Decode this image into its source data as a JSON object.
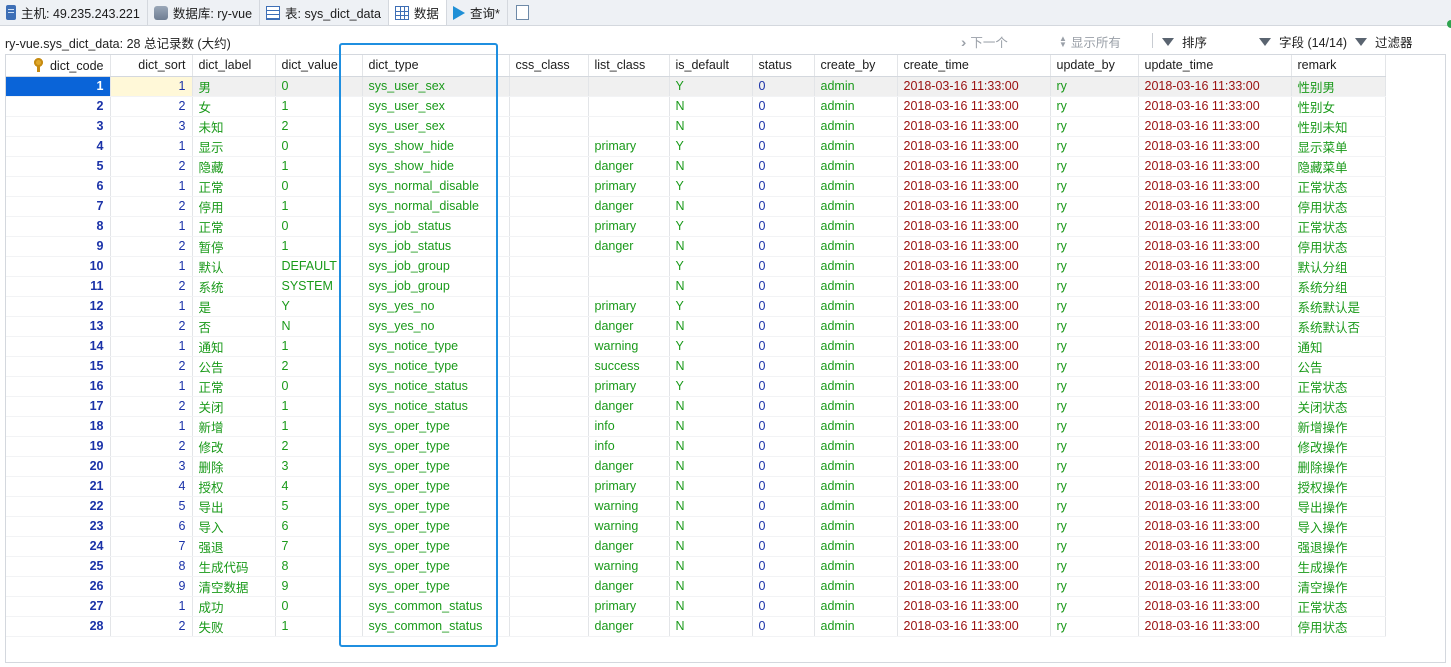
{
  "tabs": [
    {
      "icon": "server-icon",
      "label": "主机: 49.235.243.221"
    },
    {
      "icon": "database-icon",
      "label": "数据库: ry-vue"
    },
    {
      "icon": "table-icon",
      "label": "表: sys_dict_data"
    },
    {
      "icon": "grid-icon",
      "label": "数据"
    },
    {
      "icon": "query-play-icon",
      "label": "查询*"
    }
  ],
  "toolbar": {
    "summary": "ry-vue.sys_dict_data: 28 总记录数 (大约)",
    "next_label": "下一个",
    "show_all_label": "显示所有",
    "sort_label": "排序",
    "fields_label": "字段 (14/14)",
    "filter_label": "过滤器"
  },
  "columns": [
    "dict_code",
    "dict_sort",
    "dict_label",
    "dict_value",
    "dict_type",
    "css_class",
    "list_class",
    "is_default",
    "status",
    "create_by",
    "create_time",
    "update_by",
    "update_time",
    "remark"
  ],
  "rows": [
    [
      "1",
      "1",
      "男",
      "0",
      "sys_user_sex",
      "",
      "",
      "Y",
      "0",
      "admin",
      "2018-03-16 11:33:00",
      "ry",
      "2018-03-16 11:33:00",
      "性别男"
    ],
    [
      "2",
      "2",
      "女",
      "1",
      "sys_user_sex",
      "",
      "",
      "N",
      "0",
      "admin",
      "2018-03-16 11:33:00",
      "ry",
      "2018-03-16 11:33:00",
      "性别女"
    ],
    [
      "3",
      "3",
      "未知",
      "2",
      "sys_user_sex",
      "",
      "",
      "N",
      "0",
      "admin",
      "2018-03-16 11:33:00",
      "ry",
      "2018-03-16 11:33:00",
      "性别未知"
    ],
    [
      "4",
      "1",
      "显示",
      "0",
      "sys_show_hide",
      "",
      "primary",
      "Y",
      "0",
      "admin",
      "2018-03-16 11:33:00",
      "ry",
      "2018-03-16 11:33:00",
      "显示菜单"
    ],
    [
      "5",
      "2",
      "隐藏",
      "1",
      "sys_show_hide",
      "",
      "danger",
      "N",
      "0",
      "admin",
      "2018-03-16 11:33:00",
      "ry",
      "2018-03-16 11:33:00",
      "隐藏菜单"
    ],
    [
      "6",
      "1",
      "正常",
      "0",
      "sys_normal_disable",
      "",
      "primary",
      "Y",
      "0",
      "admin",
      "2018-03-16 11:33:00",
      "ry",
      "2018-03-16 11:33:00",
      "正常状态"
    ],
    [
      "7",
      "2",
      "停用",
      "1",
      "sys_normal_disable",
      "",
      "danger",
      "N",
      "0",
      "admin",
      "2018-03-16 11:33:00",
      "ry",
      "2018-03-16 11:33:00",
      "停用状态"
    ],
    [
      "8",
      "1",
      "正常",
      "0",
      "sys_job_status",
      "",
      "primary",
      "Y",
      "0",
      "admin",
      "2018-03-16 11:33:00",
      "ry",
      "2018-03-16 11:33:00",
      "正常状态"
    ],
    [
      "9",
      "2",
      "暂停",
      "1",
      "sys_job_status",
      "",
      "danger",
      "N",
      "0",
      "admin",
      "2018-03-16 11:33:00",
      "ry",
      "2018-03-16 11:33:00",
      "停用状态"
    ],
    [
      "10",
      "1",
      "默认",
      "DEFAULT",
      "sys_job_group",
      "",
      "",
      "Y",
      "0",
      "admin",
      "2018-03-16 11:33:00",
      "ry",
      "2018-03-16 11:33:00",
      "默认分组"
    ],
    [
      "11",
      "2",
      "系统",
      "SYSTEM",
      "sys_job_group",
      "",
      "",
      "N",
      "0",
      "admin",
      "2018-03-16 11:33:00",
      "ry",
      "2018-03-16 11:33:00",
      "系统分组"
    ],
    [
      "12",
      "1",
      "是",
      "Y",
      "sys_yes_no",
      "",
      "primary",
      "Y",
      "0",
      "admin",
      "2018-03-16 11:33:00",
      "ry",
      "2018-03-16 11:33:00",
      "系统默认是"
    ],
    [
      "13",
      "2",
      "否",
      "N",
      "sys_yes_no",
      "",
      "danger",
      "N",
      "0",
      "admin",
      "2018-03-16 11:33:00",
      "ry",
      "2018-03-16 11:33:00",
      "系统默认否"
    ],
    [
      "14",
      "1",
      "通知",
      "1",
      "sys_notice_type",
      "",
      "warning",
      "Y",
      "0",
      "admin",
      "2018-03-16 11:33:00",
      "ry",
      "2018-03-16 11:33:00",
      "通知"
    ],
    [
      "15",
      "2",
      "公告",
      "2",
      "sys_notice_type",
      "",
      "success",
      "N",
      "0",
      "admin",
      "2018-03-16 11:33:00",
      "ry",
      "2018-03-16 11:33:00",
      "公告"
    ],
    [
      "16",
      "1",
      "正常",
      "0",
      "sys_notice_status",
      "",
      "primary",
      "Y",
      "0",
      "admin",
      "2018-03-16 11:33:00",
      "ry",
      "2018-03-16 11:33:00",
      "正常状态"
    ],
    [
      "17",
      "2",
      "关闭",
      "1",
      "sys_notice_status",
      "",
      "danger",
      "N",
      "0",
      "admin",
      "2018-03-16 11:33:00",
      "ry",
      "2018-03-16 11:33:00",
      "关闭状态"
    ],
    [
      "18",
      "1",
      "新增",
      "1",
      "sys_oper_type",
      "",
      "info",
      "N",
      "0",
      "admin",
      "2018-03-16 11:33:00",
      "ry",
      "2018-03-16 11:33:00",
      "新增操作"
    ],
    [
      "19",
      "2",
      "修改",
      "2",
      "sys_oper_type",
      "",
      "info",
      "N",
      "0",
      "admin",
      "2018-03-16 11:33:00",
      "ry",
      "2018-03-16 11:33:00",
      "修改操作"
    ],
    [
      "20",
      "3",
      "删除",
      "3",
      "sys_oper_type",
      "",
      "danger",
      "N",
      "0",
      "admin",
      "2018-03-16 11:33:00",
      "ry",
      "2018-03-16 11:33:00",
      "删除操作"
    ],
    [
      "21",
      "4",
      "授权",
      "4",
      "sys_oper_type",
      "",
      "primary",
      "N",
      "0",
      "admin",
      "2018-03-16 11:33:00",
      "ry",
      "2018-03-16 11:33:00",
      "授权操作"
    ],
    [
      "22",
      "5",
      "导出",
      "5",
      "sys_oper_type",
      "",
      "warning",
      "N",
      "0",
      "admin",
      "2018-03-16 11:33:00",
      "ry",
      "2018-03-16 11:33:00",
      "导出操作"
    ],
    [
      "23",
      "6",
      "导入",
      "6",
      "sys_oper_type",
      "",
      "warning",
      "N",
      "0",
      "admin",
      "2018-03-16 11:33:00",
      "ry",
      "2018-03-16 11:33:00",
      "导入操作"
    ],
    [
      "24",
      "7",
      "强退",
      "7",
      "sys_oper_type",
      "",
      "danger",
      "N",
      "0",
      "admin",
      "2018-03-16 11:33:00",
      "ry",
      "2018-03-16 11:33:00",
      "强退操作"
    ],
    [
      "25",
      "8",
      "生成代码",
      "8",
      "sys_oper_type",
      "",
      "warning",
      "N",
      "0",
      "admin",
      "2018-03-16 11:33:00",
      "ry",
      "2018-03-16 11:33:00",
      "生成操作"
    ],
    [
      "26",
      "9",
      "清空数据",
      "9",
      "sys_oper_type",
      "",
      "danger",
      "N",
      "0",
      "admin",
      "2018-03-16 11:33:00",
      "ry",
      "2018-03-16 11:33:00",
      "清空操作"
    ],
    [
      "27",
      "1",
      "成功",
      "0",
      "sys_common_status",
      "",
      "primary",
      "N",
      "0",
      "admin",
      "2018-03-16 11:33:00",
      "ry",
      "2018-03-16 11:33:00",
      "正常状态"
    ],
    [
      "28",
      "2",
      "失败",
      "1",
      "sys_common_status",
      "",
      "danger",
      "N",
      "0",
      "admin",
      "2018-03-16 11:33:00",
      "ry",
      "2018-03-16 11:33:00",
      "停用状态"
    ]
  ],
  "colors": {
    "text_green": "#1a9a1a",
    "id_blue": "#1a32a8",
    "timestamp_red": "#9a1010",
    "selection_blue": "#0a64d8",
    "highlight_box": "#1f8fe0"
  }
}
